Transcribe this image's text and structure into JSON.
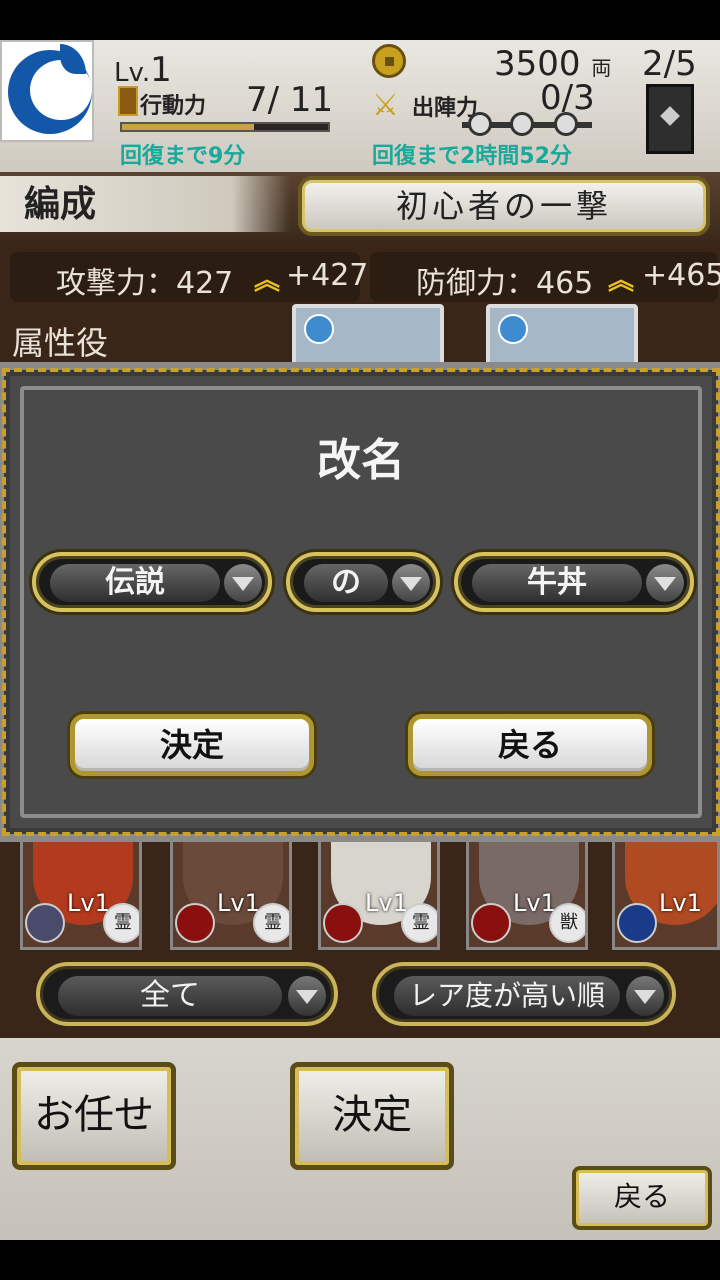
{
  "hud": {
    "level_prefix": "Lv.",
    "level": "1",
    "ap_label": "行動力",
    "ap_value": "7/ 11",
    "ap_fill": 0.64,
    "ap_recover": "回復まで9分",
    "gold": "3500",
    "gold_unit": "両",
    "sortie_label": "出陣力",
    "sortie_value": "0/3",
    "sortie_recover": "回復まで2時間52分",
    "page_count": "2/5"
  },
  "screen": {
    "title": "編成",
    "deck_name": "初心者の一撃",
    "attack_label": "攻撃力：427",
    "attack_bonus": "+427",
    "defense_label": "防御力：465",
    "defense_bonus": "+465",
    "attr_label": "属性役",
    "characters": [
      {
        "lvl": "Lv1",
        "badge": "霊"
      },
      {
        "lvl": "Lv1",
        "badge": "霊"
      },
      {
        "lvl": "Lv1",
        "badge": "霊"
      },
      {
        "lvl": "Lv1",
        "badge": "獣"
      },
      {
        "lvl": "Lv1",
        "badge": ""
      }
    ],
    "filter": "全て",
    "sort": "レア度が高い順",
    "auto_button": "お任せ",
    "confirm_button": "決定",
    "back_button": "戻る"
  },
  "modal": {
    "title": "改名",
    "select1": "伝説",
    "select2": "の",
    "select3": "牛丼",
    "confirm": "決定",
    "back": "戻る"
  },
  "colors": {
    "accent_gold": "#c9b45a",
    "recover_text": "#1aa89a",
    "modal_bg": "#4a4a4a"
  }
}
